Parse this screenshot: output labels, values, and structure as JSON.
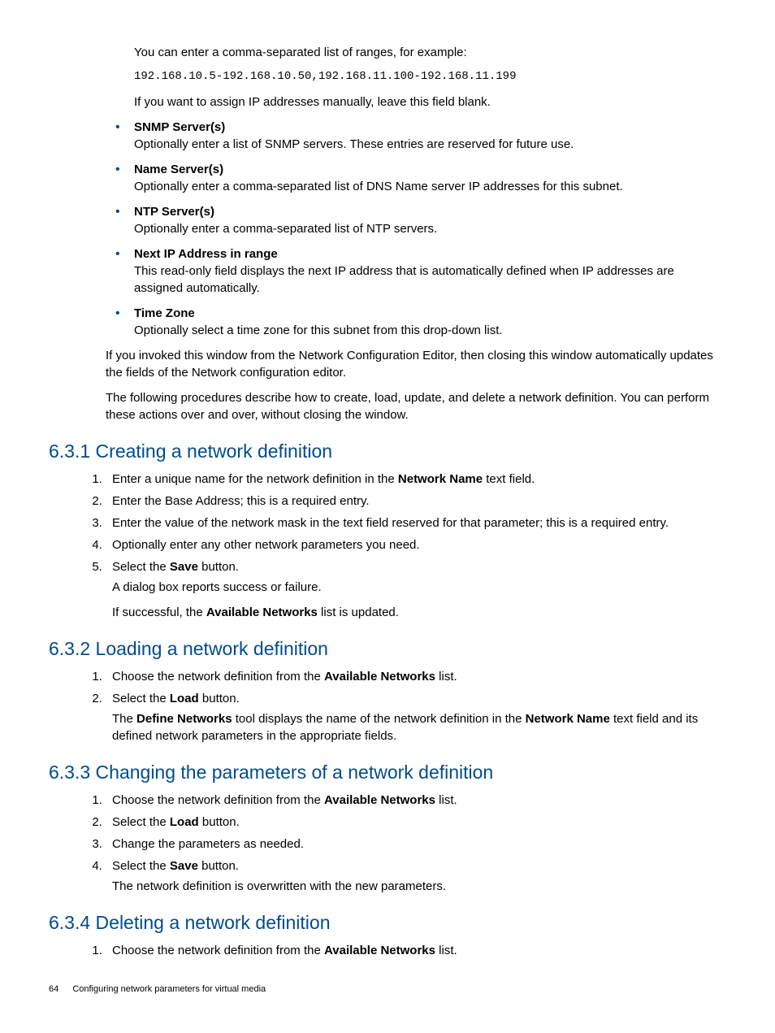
{
  "intro": {
    "p1": "You can enter a comma-separated list of ranges, for example:",
    "code": "192.168.10.5-192.168.10.50,192.168.11.100-192.168.11.199",
    "p2": "If you want to assign IP addresses manually, leave this field blank."
  },
  "bullets": [
    {
      "title": "SNMP Server(s)",
      "desc": "Optionally enter a list of SNMP servers. These entries are reserved for future use."
    },
    {
      "title": "Name Server(s)",
      "desc": "Optionally enter a comma-separated list of DNS Name server IP addresses for this subnet."
    },
    {
      "title": "NTP Server(s)",
      "desc": "Optionally enter a comma-separated list of NTP servers."
    },
    {
      "title": "Next IP Address in range",
      "desc": "This read-only field displays the next IP address that is automatically defined when IP addresses are assigned automatically."
    },
    {
      "title": "Time Zone",
      "desc": "Optionally select a time zone for this subnet from this drop-down list."
    }
  ],
  "after1": "If you invoked this window from the Network Configuration Editor, then closing this window automatically updates the fields of the Network configuration editor.",
  "after2": "The following procedures describe how to create, load, update, and delete a network definition. You can perform these actions over and over, without closing the window.",
  "s631": {
    "h": "6.3.1 Creating a network definition",
    "li1a": "Enter a unique name for the network definition in the ",
    "li1b": "Network Name",
    "li1c": " text field.",
    "li2": "Enter the Base Address; this is a required entry.",
    "li3": "Enter the value of the network mask in the text field reserved for that parameter; this is a required entry.",
    "li4": "Optionally enter any other network parameters you need.",
    "li5a": "Select the ",
    "li5b": "Save",
    "li5c": " button.",
    "p1": "A dialog box reports success or failure.",
    "p2a": "If successful, the ",
    "p2b": "Available Networks",
    "p2c": " list is updated."
  },
  "s632": {
    "h": "6.3.2 Loading a network definition",
    "li1a": "Choose the network definition from the ",
    "li1b": "Available Networks",
    "li1c": " list.",
    "li2a": "Select the ",
    "li2b": "Load",
    "li2c": " button.",
    "p1a": "The ",
    "p1b": "Define Networks",
    "p1c": " tool displays the name of the network definition in the ",
    "p1d": "Network Name",
    "p1e": " text field and its defined network parameters in the appropriate fields."
  },
  "s633": {
    "h": "6.3.3 Changing the parameters of a network definition",
    "li1a": "Choose the network definition from the ",
    "li1b": "Available Networks",
    "li1c": " list.",
    "li2a": "Select the ",
    "li2b": "Load",
    "li2c": " button.",
    "li3": "Change the parameters as needed.",
    "li4a": "Select the ",
    "li4b": "Save",
    "li4c": " button.",
    "p1": "The network definition is overwritten with the new parameters."
  },
  "s634": {
    "h": "6.3.4 Deleting a network definition",
    "li1a": "Choose the network definition from the ",
    "li1b": "Available Networks",
    "li1c": " list."
  },
  "footer": {
    "page": "64",
    "title": "Configuring network parameters for virtual media"
  }
}
